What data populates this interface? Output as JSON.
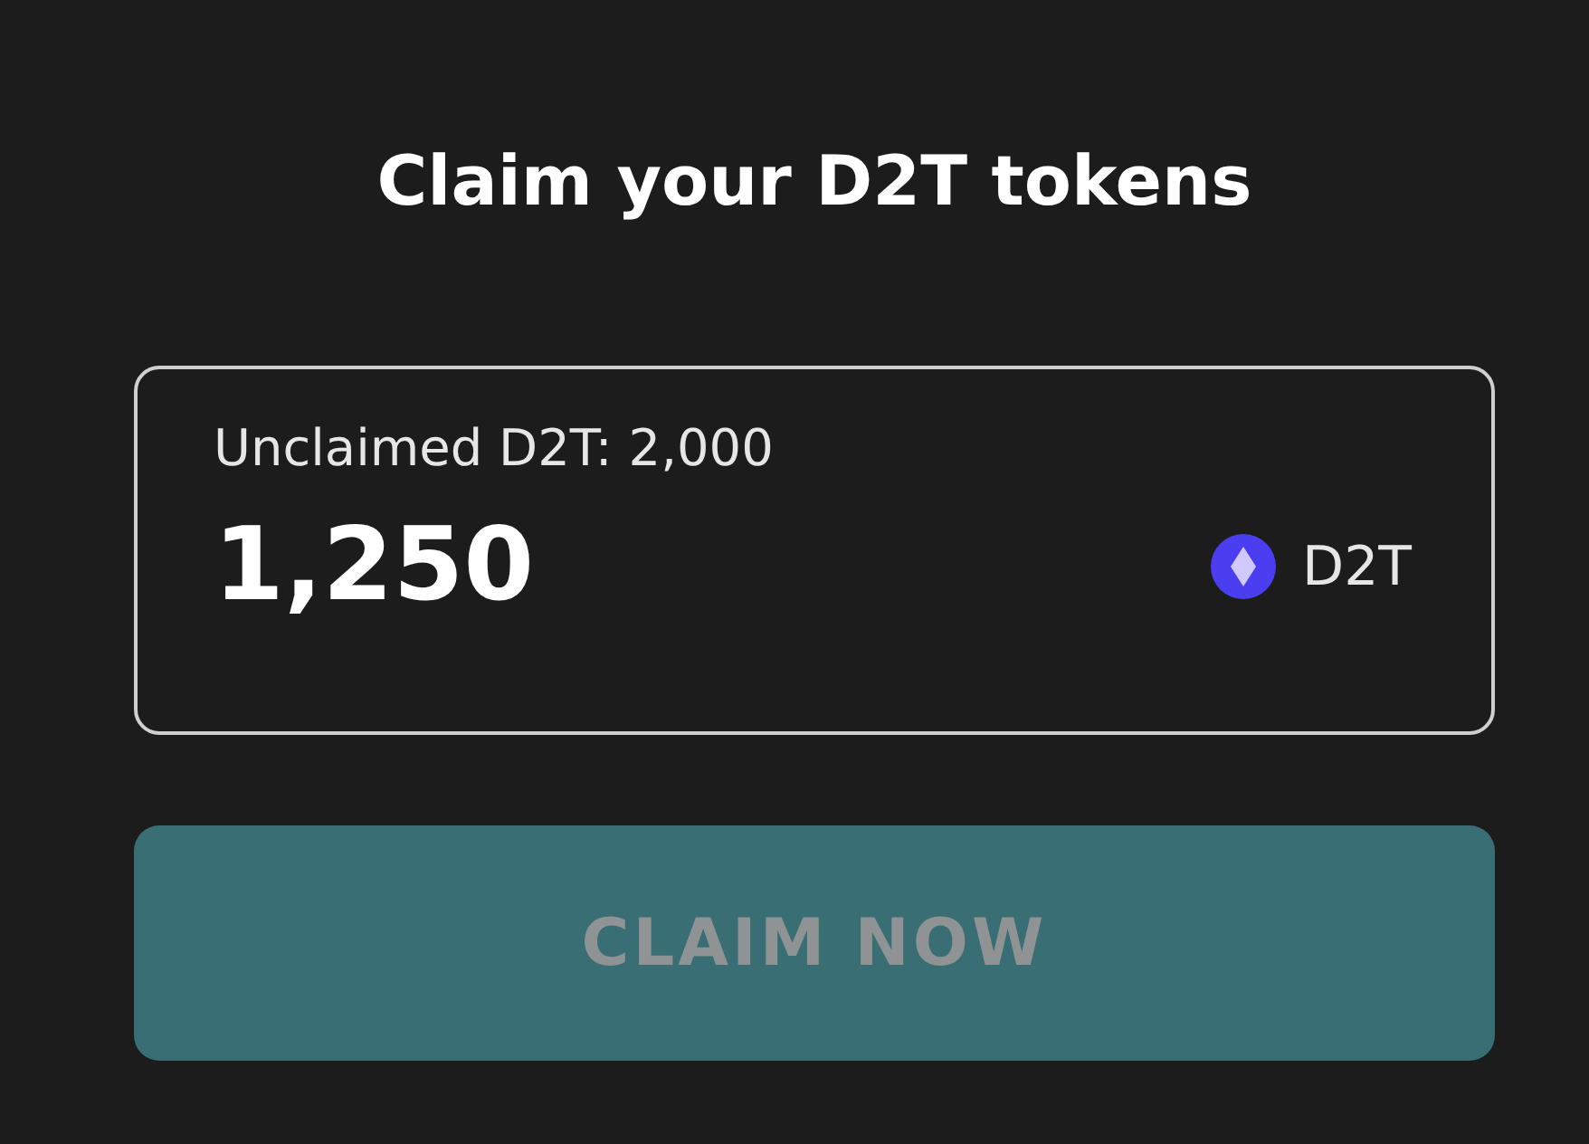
{
  "title": "Claim your D2T tokens",
  "amount_field": {
    "label": "Unclaimed D2T: 2,000",
    "value": "1,250",
    "token": "D2T"
  },
  "claim_button": {
    "label": "CLAIM NOW",
    "disabled": true
  }
}
